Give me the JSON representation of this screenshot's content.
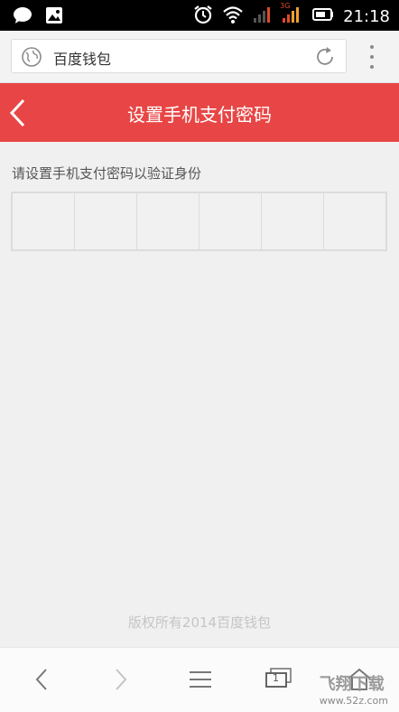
{
  "status_bar": {
    "time": "21:18",
    "network_label": "3G",
    "icons": [
      "chat-bubble-icon",
      "image-icon",
      "alarm-icon",
      "wifi-icon",
      "signal-icon",
      "signal-icon",
      "battery-icon"
    ]
  },
  "browser": {
    "url_text": "百度钱包",
    "icons": {
      "site": "globe-icon",
      "reload": "reload-icon",
      "menu": "more-vert-icon"
    }
  },
  "header": {
    "title": "设置手机支付密码",
    "back_icon": "chevron-left-icon",
    "bg_color": "#e84646"
  },
  "main": {
    "prompt": "请设置手机支付密码以验证身份",
    "pin_length": 6
  },
  "footer": {
    "copyright": "版权所有2014百度钱包"
  },
  "nav": {
    "buttons": [
      "back-icon",
      "forward-icon",
      "menu-icon",
      "tabs-icon",
      "home-icon"
    ],
    "tab_count": "1",
    "watermark_brand": "飞翔下载",
    "watermark_url": "www.52z.com"
  }
}
